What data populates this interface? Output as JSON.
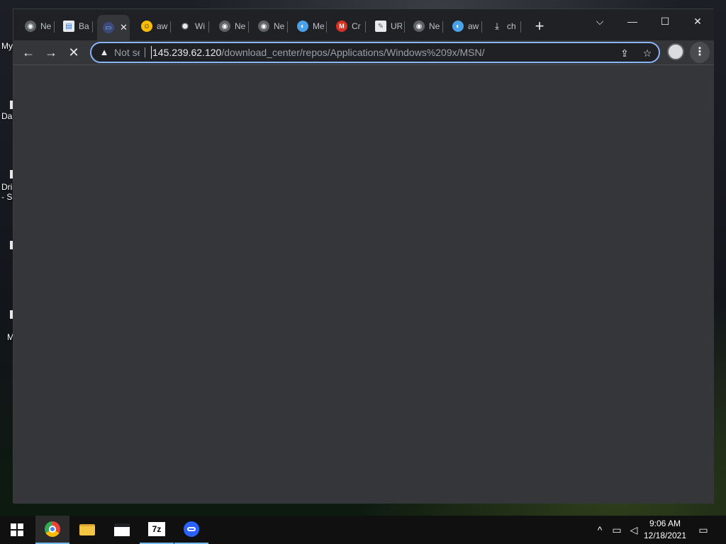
{
  "desktop": {
    "icon_labels": [
      "My",
      "Da",
      "Dri",
      "- S",
      "M"
    ]
  },
  "browser": {
    "tabs": [
      {
        "favicon": "chrome-icon",
        "title": "Ne",
        "color": "#e8eaed"
      },
      {
        "favicon": "ba-icon",
        "title": "Ba",
        "color": "#ffffff"
      },
      {
        "favicon": "app-icon",
        "title": "",
        "color": "#8ab4f8",
        "active": true
      },
      {
        "favicon": "emoji-icon",
        "title": "aw",
        "color": "#fbbc04"
      },
      {
        "favicon": "gear-icon",
        "title": "Wi",
        "color": "#e8eaed"
      },
      {
        "favicon": "chrome-icon",
        "title": "Ne",
        "color": "#e8eaed"
      },
      {
        "favicon": "chrome-icon",
        "title": "Ne",
        "color": "#e8eaed"
      },
      {
        "favicon": "edge-icon",
        "title": "Me",
        "color": "#4aa1e8"
      },
      {
        "favicon": "mega-icon",
        "title": "Cr",
        "color": "#d93025"
      },
      {
        "favicon": "pen-icon",
        "title": "UR",
        "color": "#ffffff"
      },
      {
        "favicon": "chrome-icon",
        "title": "Ne",
        "color": "#e8eaed"
      },
      {
        "favicon": "edge-icon",
        "title": "aw",
        "color": "#4aa1e8"
      },
      {
        "favicon": "download-icon",
        "title": "ch",
        "color": "#e8eaed"
      }
    ],
    "active_close_glyph": "✕",
    "new_tab_glyph": "+",
    "window_controls": {
      "tab_search": "⌵",
      "minimize": "—",
      "maximize": "☐",
      "close": "✕"
    },
    "nav": {
      "back": "←",
      "forward": "→",
      "stop": "✕"
    },
    "omnibox": {
      "warning_glyph": "▲",
      "security_text": "Not secure",
      "url_host": "145.239.62.120",
      "url_path": "/download_center/repos/Applications/Windows%209x/MSN/",
      "share_glyph": "⇪",
      "bookmark_glyph": "☆"
    },
    "menu_glyph": "⋮"
  },
  "taskbar": {
    "apps": [
      {
        "name": "start-button",
        "glyph": "⊞"
      },
      {
        "name": "chrome-taskbar-icon",
        "glyph": "",
        "state": "active"
      },
      {
        "name": "file-explorer-taskbar-icon",
        "glyph": ""
      },
      {
        "name": "clapper-taskbar-icon",
        "glyph": ""
      },
      {
        "name": "7zip-taskbar-icon",
        "glyph": "7z",
        "state": "running"
      },
      {
        "name": "app-taskbar-icon",
        "glyph": "",
        "state": "running"
      }
    ],
    "tray": {
      "chevron": "^",
      "time": "9:06 AM",
      "date": "12/18/2021",
      "notification_glyph": "▭"
    }
  }
}
